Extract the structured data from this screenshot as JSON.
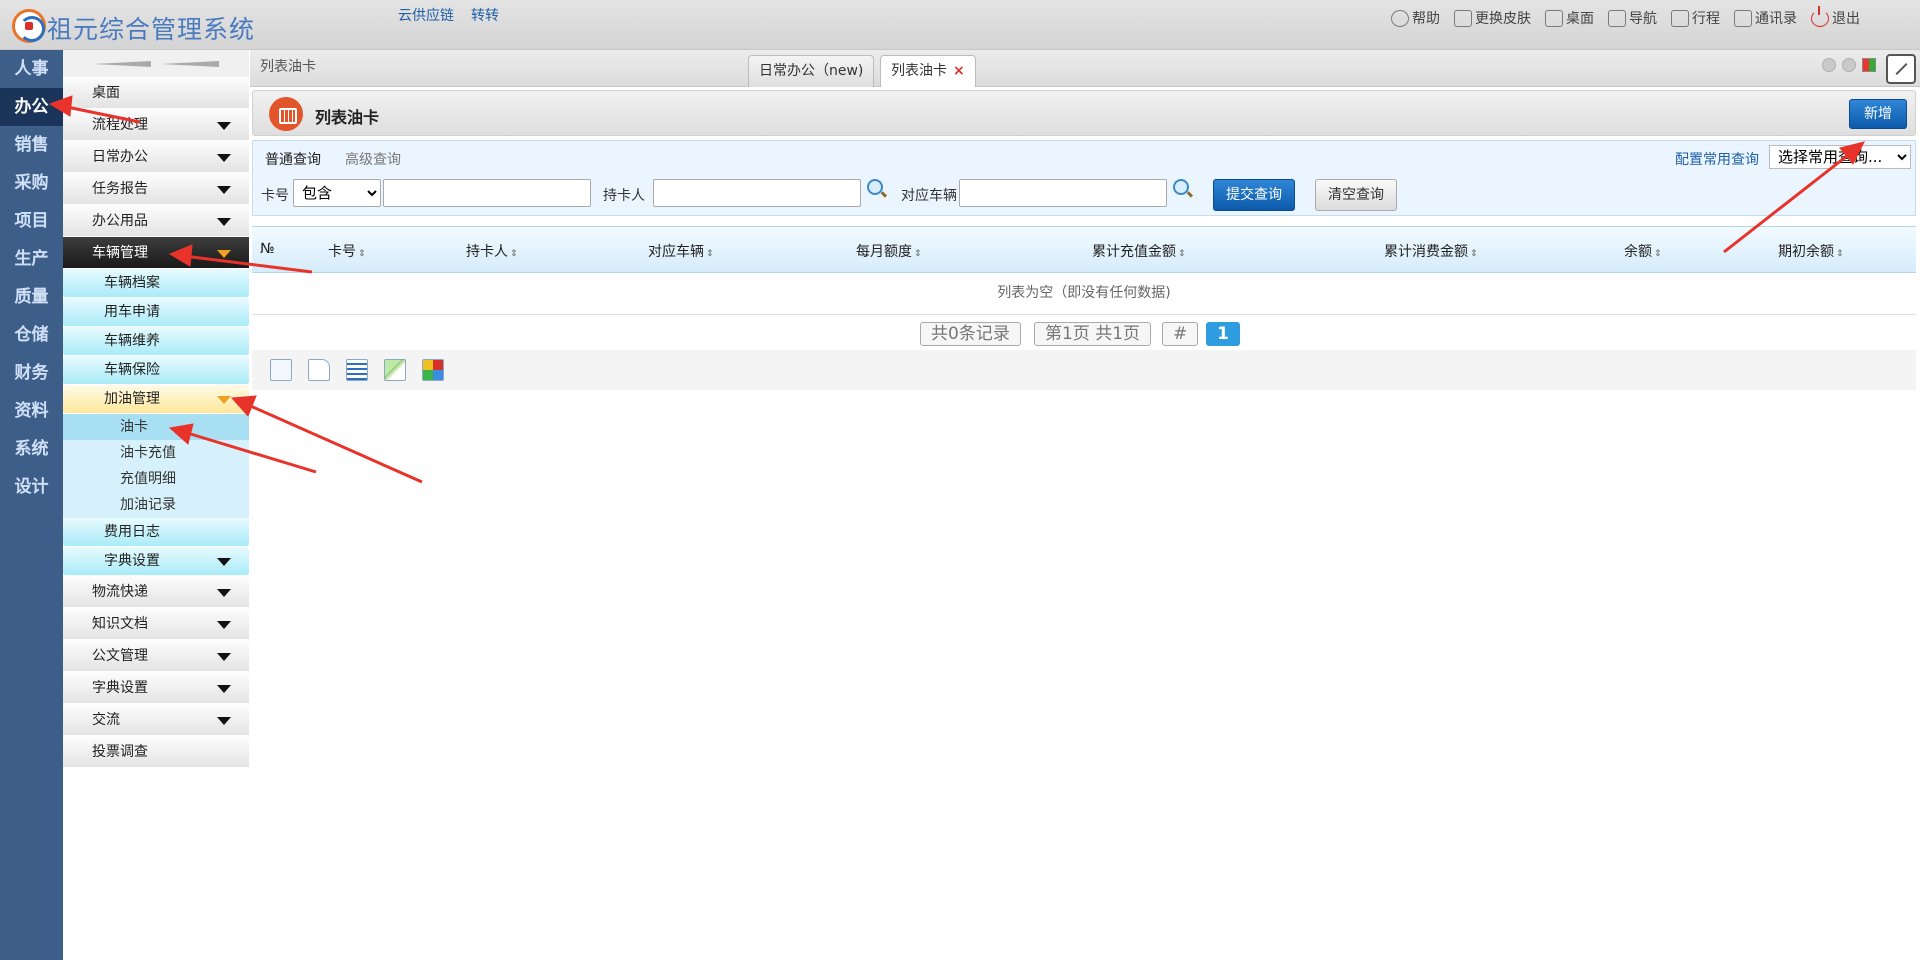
{
  "header": {
    "app_title": "祖元综合管理系统",
    "links": [
      "云供应链",
      "转转"
    ],
    "tools": [
      {
        "label": "帮助",
        "icon": "help-icon"
      },
      {
        "label": "更换皮肤",
        "icon": "shirt-icon"
      },
      {
        "label": "桌面",
        "icon": "home-icon"
      },
      {
        "label": "导航",
        "icon": "nav-grid-icon"
      },
      {
        "label": "行程",
        "icon": "calendar-icon"
      },
      {
        "label": "通讯录",
        "icon": "contacts-icon"
      },
      {
        "label": "退出",
        "icon": "power-icon"
      }
    ]
  },
  "modules": [
    "人事",
    "办公",
    "销售",
    "采购",
    "项目",
    "生产",
    "质量",
    "仓储",
    "财务",
    "资料",
    "系统",
    "设计"
  ],
  "active_module": "办公",
  "menu": {
    "desktop": "桌面",
    "items_top": [
      "流程处理",
      "日常办公",
      "任务报告",
      "办公用品"
    ],
    "vehicle": "车辆管理",
    "vehicle_children": [
      "车辆档案",
      "用车申请",
      "车辆维养",
      "车辆保险"
    ],
    "fuel": "加油管理",
    "fuel_children": [
      "油卡",
      "油卡充值",
      "充值明细",
      "加油记录"
    ],
    "vehicle_after": [
      "费用日志",
      "字典设置"
    ],
    "items_bottom": [
      "物流快递",
      "知识文档",
      "公文管理",
      "字典设置",
      "交流"
    ],
    "last": "投票调查"
  },
  "tabs": {
    "breadcrumb": "列表油卡",
    "items": [
      "日常办公（new)",
      "列表油卡"
    ],
    "close": "×"
  },
  "page": {
    "title": "列表油卡",
    "add_button": "新增"
  },
  "query": {
    "tab_simple": "普通查询",
    "tab_advanced": "高级查询",
    "config_link": "配置常用查询",
    "saved_select": "选择常用查询...",
    "card_label": "卡号",
    "card_op": "包含",
    "card_value": "",
    "holder_label": "持卡人",
    "holder_value": "",
    "vehicle_label": "对应车辆",
    "vehicle_value": "",
    "submit": "提交查询",
    "clear": "清空查询"
  },
  "table": {
    "columns": [
      "№",
      "卡号",
      "持卡人",
      "对应车辆",
      "每月额度",
      "累计充值金额",
      "累计消费金额",
      "余额",
      "期初余额"
    ],
    "sort_glyph": "⇕",
    "empty": "列表为空（即没有任何数据)"
  },
  "pager": {
    "total": "共0条记录",
    "page_info": "第1页 共1页",
    "hash": "#",
    "current": "1"
  },
  "toolbar_icons": [
    "select-all-icon",
    "new-doc-icon",
    "grid-icon",
    "edit-icon",
    "puzzle-icon"
  ],
  "colors": {
    "module_bg": "#3e5e8a",
    "accent_blue": "#0d5aab",
    "annotation_red": "#e8332b"
  }
}
